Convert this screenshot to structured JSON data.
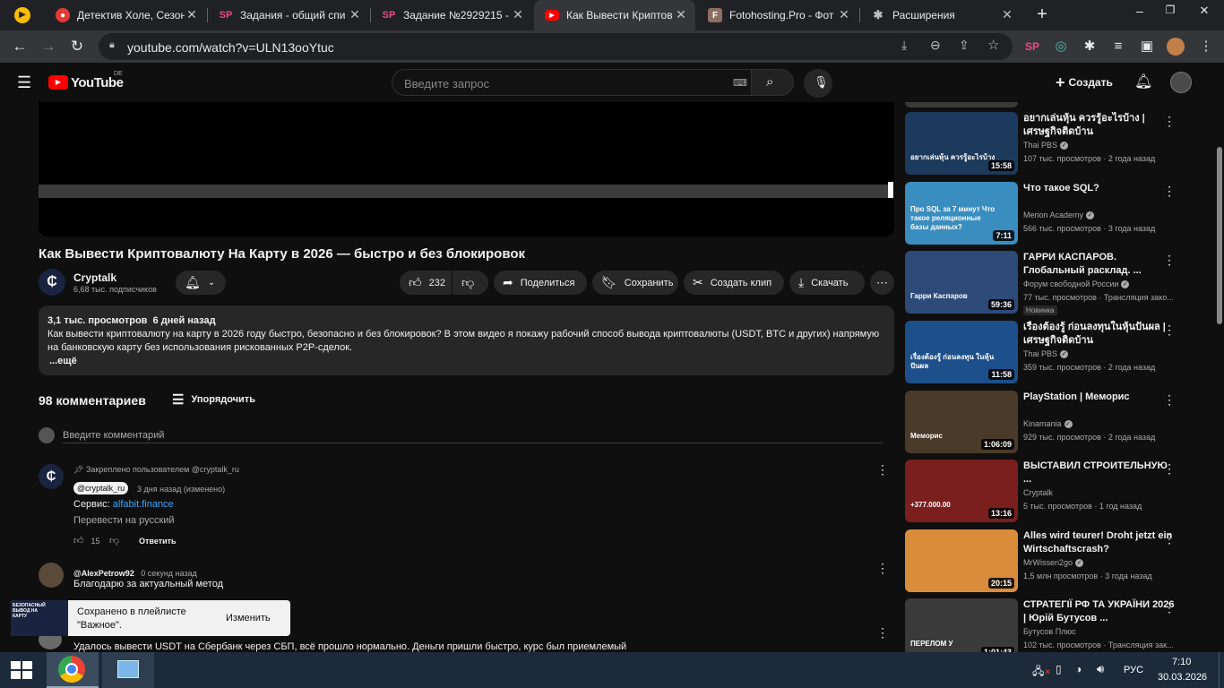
{
  "browser": {
    "tabs": [
      {
        "title": "Детектив Холе, Сезон",
        "fav_color": "#e53935",
        "fav_glyph": "●"
      },
      {
        "title": "Задания - общий спи",
        "fav_color": "#1e3a8a",
        "fav_glyph": "SP"
      },
      {
        "title": "Задание №2929215 -",
        "fav_color": "#1e3a8a",
        "fav_glyph": "SP"
      },
      {
        "title": "Как Вывести Криптов",
        "fav_color": "#ff0000",
        "fav_glyph": "▶"
      },
      {
        "title": "Fotohosting.Pro - Фот",
        "fav_color": "#8d6e63",
        "fav_glyph": "F"
      },
      {
        "title": "Расширения",
        "fav_color": "#5f6368",
        "fav_glyph": "✱"
      }
    ],
    "url": "youtube.com/watch?v=ULN13ooYtuc"
  },
  "youtube": {
    "logo_text": "YouTube",
    "region": "DE",
    "search_placeholder": "Введите запрос",
    "create_label": "Создать"
  },
  "video": {
    "title": "Как Вывести Криптовалюту На Карту в 2026 — быстро и без блокировок",
    "channel": "Cryptalk",
    "subscribers": "6,68 тыс. подписчиков",
    "likes": "232",
    "share_label": "Поделиться",
    "save_label": "Сохранить",
    "clip_label": "Создать клип",
    "download_label": "Скачать",
    "views_date": "3,1 тыс. просмотров  6 дней назад",
    "description": "Как вывести криптовалюту на карту в 2026 году быстро, безопасно и без блокировок? В этом видео я покажу рабочий способ вывода криптовалюты (USDT, BTC и других) напрямую на банковскую карту без использования рискованных P2P-сделок.",
    "more_label": "...ещё"
  },
  "comments": {
    "count_label": "98 комментариев",
    "sort_label": "Упорядочить",
    "input_placeholder": "Введите комментарий",
    "pinned": {
      "pinned_label": "Закреплено пользователем @cryptalk_ru",
      "author": "@cryptalk_ru",
      "time": "3 дня назад (изменено)",
      "service_label": "Сервис:",
      "service_link": "alfabit.finance",
      "translate_label": "Перевести на русский",
      "likes": "15",
      "reply_label": "Ответить"
    },
    "second": {
      "author": "@AlexPetrow92",
      "time": "0 секунд назад",
      "text": "Благодарю за актуальный метод"
    },
    "third": {
      "text": "Удалось вывести USDT на Сбербанк через СБП, всё прошло нормально. Деньги пришли быстро, курс был приемлемый"
    }
  },
  "toast": {
    "thumb_text": "БЕЗОПАСНЫЙ ВЫВОД НА КАРТУ",
    "line1": "Сохранено в плейлисте",
    "line2": "\"Важное\".",
    "action": "Изменить"
  },
  "sidebar": [
    {
      "title": "อยากเล่นหุ้น ควรรู้อะไรบ้าง | เศรษฐกิจติดบ้าน",
      "channel": "Thai PBS",
      "verified": true,
      "stats": "107 тыс. просмотров · 2 года назад",
      "duration": "15:58",
      "thumb_text": "อยากเล่นหุ้น ควรรู้อะไรบ้าง",
      "thumb_color": "#1b3a5c",
      "badge": ""
    },
    {
      "title": "Что такое SQL?",
      "channel": "Merion Academy",
      "verified": true,
      "stats": "566 тыс. просмотров · 3 года назад",
      "duration": "7:11",
      "thumb_text": "Про SQL за 7 минут Что такое реляционные базы данных?",
      "thumb_color": "#3a8dbf",
      "badge": ""
    },
    {
      "title": "ГАРРИ КАСПАРОВ. Глобальный расклад. ...",
      "channel": "Форум свободной России",
      "verified": true,
      "stats": "77 тыс. просмотров · Трансляция зако...",
      "duration": "59:36",
      "thumb_text": "Гарри Каспаров",
      "thumb_color": "#2d4a78",
      "badge": "Новинка"
    },
    {
      "title": "เรื่องต้องรู้ ก่อนลงทุนในหุ้นปันผล | เศรษฐกิจติดบ้าน",
      "channel": "Thai PBS",
      "verified": true,
      "stats": "359 тыс. просмотров · 2 года назад",
      "duration": "11:58",
      "thumb_text": "เรื่องต้องรู้ ก่อนลงทุน ในหุ้นปันผล",
      "thumb_color": "#1d4f8a",
      "badge": ""
    },
    {
      "title": "PlayStation | Меморис",
      "channel": "Kinamania",
      "verified": true,
      "stats": "929 тыс. просмотров · 2 года назад",
      "duration": "1:06:09",
      "thumb_text": "Меморис",
      "thumb_color": "#4a3a2a",
      "badge": ""
    },
    {
      "title": "ВЫСТАВИЛ СТРОИТЕЛЬНУЮ ...",
      "channel": "Cryptalk",
      "verified": false,
      "stats": "5 тыс. просмотров · 1 год назад",
      "duration": "13:16",
      "thumb_text": "+377.000.00",
      "thumb_color": "#7a1e1e",
      "badge": ""
    },
    {
      "title": "Alles wird teurer! Droht jetzt ein Wirtschaftscrash?",
      "channel": "MrWissen2go",
      "verified": true,
      "stats": "1,5 млн просмотров · 3 года назад",
      "duration": "20:15",
      "thumb_text": "",
      "thumb_color": "#d98c3a",
      "badge": ""
    },
    {
      "title": "СТРАТЕГІЇ РФ ТА УКРАЇНИ 2026 | Юрій Бутусов ...",
      "channel": "Бутусов Плюс",
      "verified": false,
      "stats": "102 тыс. просмотров · Трансляция зак...",
      "duration": "1:01:43",
      "thumb_text": "ПЕРЕЛОМ У",
      "thumb_color": "#3a3a3a",
      "badge": ""
    }
  ],
  "taskbar": {
    "lang": "РУС",
    "time": "7:10",
    "date": "30.03.2026"
  },
  "colors": {
    "accent_red": "#ff0000",
    "link_blue": "#3ea6ff",
    "bg": "#0f0f0f"
  }
}
